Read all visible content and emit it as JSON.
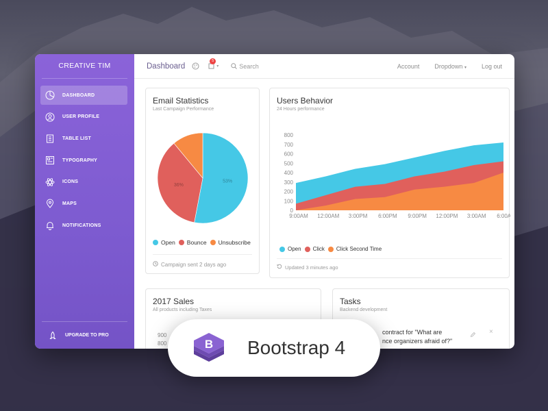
{
  "colors": {
    "sidebar_top": "#8b63d9",
    "sidebar_bottom": "#7453c6",
    "open": "#45c8e6",
    "bounce": "#e0605c",
    "unsubscribe": "#f78a43"
  },
  "sidebar": {
    "brand": "CREATIVE TIM",
    "items": [
      {
        "label": "DASHBOARD",
        "icon": "chart-pie-icon",
        "active": true
      },
      {
        "label": "USER PROFILE",
        "icon": "user-icon"
      },
      {
        "label": "TABLE LIST",
        "icon": "clipboard-icon"
      },
      {
        "label": "TYPOGRAPHY",
        "icon": "paper-icon"
      },
      {
        "label": "ICONS",
        "icon": "atom-icon"
      },
      {
        "label": "MAPS",
        "icon": "map-pin-icon"
      },
      {
        "label": "NOTIFICATIONS",
        "icon": "bell-icon"
      }
    ],
    "upgrade": {
      "label": "UPGRADE TO PRO",
      "icon": "rocket-icon"
    }
  },
  "topbar": {
    "title": "Dashboard",
    "notification_count": "5",
    "search_label": "Search",
    "links": [
      "Account",
      "Dropdown",
      "Log out"
    ]
  },
  "email_stats": {
    "title": "Email Statistics",
    "subtitle": "Last Campaign Performance",
    "legend": [
      "Open",
      "Bounce",
      "Unsubscribe"
    ],
    "footer": "Campaign sent 2 days ago"
  },
  "users_behavior": {
    "title": "Users Behavior",
    "subtitle": "24 Hours performance",
    "legend": [
      "Open",
      "Click",
      "Click Second Time"
    ],
    "footer": "Updated 3 minutes ago"
  },
  "sales": {
    "title": "2017 Sales",
    "subtitle": "All products including Taxes",
    "ticks_visible": [
      "900",
      "800"
    ]
  },
  "tasks": {
    "title": "Tasks",
    "subtitle": "Backend development",
    "item_line1": "contract for \"What are",
    "item_line2": "nce organizers afraid of?\""
  },
  "badge": {
    "label": "Bootstrap 4",
    "logo_letter": "B"
  },
  "chart_data": [
    {
      "type": "pie",
      "title": "Email Statistics",
      "categories": [
        "Open",
        "Bounce",
        "Unsubscribe"
      ],
      "values": [
        53,
        36,
        11
      ],
      "slice_labels": [
        "53%",
        "36%",
        ""
      ],
      "colors": [
        "#45c8e6",
        "#e0605c",
        "#f78a43"
      ],
      "legend_position": "bottom"
    },
    {
      "type": "area",
      "title": "Users Behavior",
      "x": [
        "9:00AM",
        "12:00AM",
        "3:00PM",
        "6:00PM",
        "9:00PM",
        "12:00PM",
        "3:00AM",
        "6:00AM"
      ],
      "ylim": [
        0,
        800
      ],
      "yticks": [
        0,
        100,
        200,
        300,
        400,
        500,
        600,
        700,
        800
      ],
      "grid": false,
      "legend_position": "bottom",
      "series": [
        {
          "name": "Open",
          "color": "#45c8e6",
          "values": [
            290,
            360,
            440,
            490,
            560,
            630,
            690,
            720
          ]
        },
        {
          "name": "Click",
          "color": "#e0605c",
          "values": [
            70,
            160,
            250,
            280,
            360,
            410,
            480,
            520
          ]
        },
        {
          "name": "Click Second Time",
          "color": "#f78a43",
          "values": [
            0,
            50,
            120,
            140,
            220,
            250,
            290,
            400
          ]
        }
      ]
    }
  ]
}
